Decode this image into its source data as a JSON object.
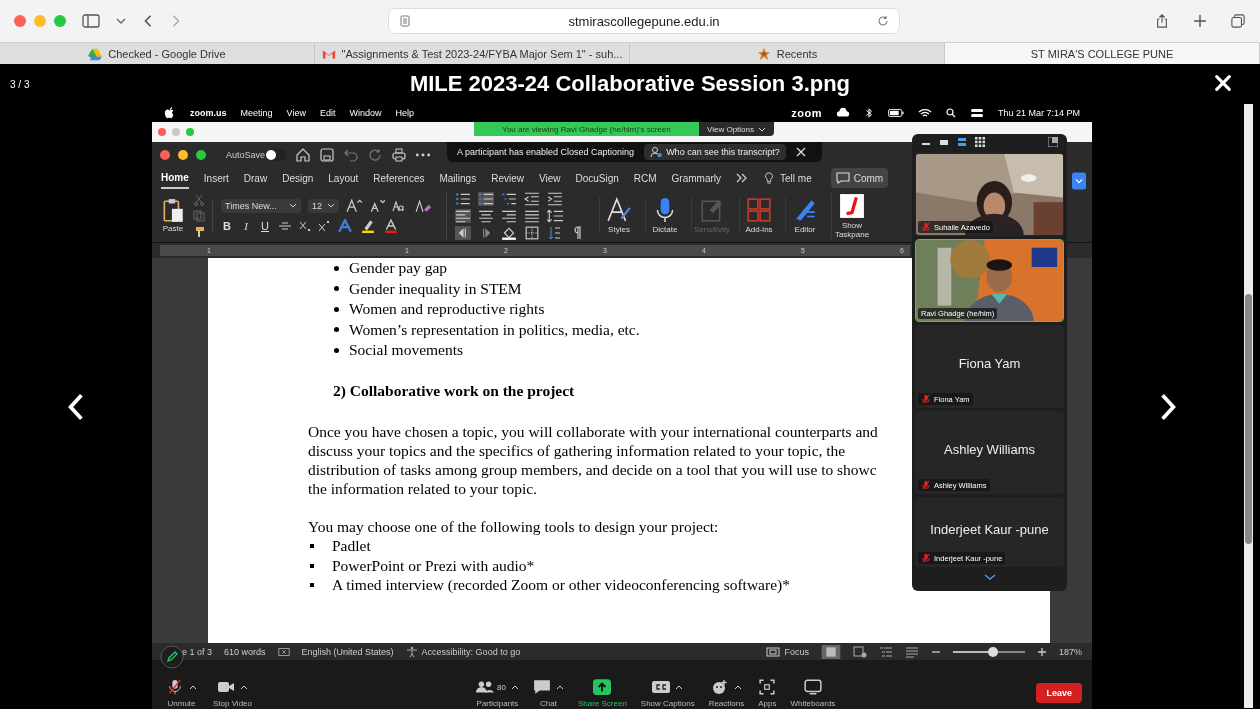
{
  "browser": {
    "url": "stmirascollegepune.edu.in",
    "tabs": [
      {
        "title": "Checked - Google Drive",
        "selected": false
      },
      {
        "title": "\"Assignments & Test 2023-24/FYBA Major Sem 1\" - suh...",
        "selected": false
      },
      {
        "title": "Recents",
        "selected": false
      },
      {
        "title": "ST MIRA'S COLLEGE PUNE",
        "selected": true
      }
    ]
  },
  "viewer": {
    "counter": "3 / 3",
    "title": "MILE 2023-24 Collaborative Session 3.png"
  },
  "menubar": {
    "app": "zoom.us",
    "items": [
      "Meeting",
      "View",
      "Edit",
      "Window",
      "Help"
    ],
    "brand": "zoom",
    "clock": "Thu 21 Mar 7:14 PM"
  },
  "share_banner": {
    "text": "You are viewing Ravi Ghadge (he/him)'s screen",
    "button": "View Options"
  },
  "caption_notice": {
    "text": "A participant has enabled Closed Captioning",
    "link": "Who can see this transcript?"
  },
  "word": {
    "autosave": {
      "label": "AutoSave",
      "on": false
    },
    "tabs": [
      {
        "label": "Home",
        "selected": true
      },
      {
        "label": "Insert",
        "selected": false
      },
      {
        "label": "Draw",
        "selected": false
      },
      {
        "label": "Design",
        "selected": false
      },
      {
        "label": "Layout",
        "selected": false
      },
      {
        "label": "References",
        "selected": false
      },
      {
        "label": "Mailings",
        "selected": false
      },
      {
        "label": "Review",
        "selected": false
      },
      {
        "label": "View",
        "selected": false
      },
      {
        "label": "DocuSign",
        "selected": false
      },
      {
        "label": "RCM",
        "selected": false
      },
      {
        "label": "Grammarly",
        "selected": false
      }
    ],
    "tell_me": "Tell me",
    "comments_button": "Comm",
    "paste": "Paste",
    "font": {
      "name": "Times New...",
      "size": "12"
    },
    "format_buttons": [
      "B",
      "I",
      "U"
    ],
    "commands": [
      {
        "label": "Styles",
        "kind": "styles",
        "disabled": false
      },
      {
        "label": "Dictate",
        "kind": "mic",
        "disabled": false
      },
      {
        "label": "Sensitivity",
        "kind": "tag",
        "disabled": true
      },
      {
        "label": "Add-ins",
        "kind": "grid",
        "disabled": false
      },
      {
        "label": "Editor",
        "kind": "pen",
        "disabled": false
      },
      {
        "label": "Show Taskpane",
        "kind": "taskpane",
        "disabled": false
      }
    ],
    "ruler": [
      "1",
      "1",
      "2",
      "3",
      "4",
      "5",
      "6"
    ],
    "document": {
      "bullets": [
        "Gender pay gap",
        "Gender inequality in STEM",
        "Women and reproductive rights",
        "Women’s representation in politics, media, etc.",
        "Social movements"
      ],
      "heading": "2) Collaborative work on the project",
      "paragraph": [
        "Once you have chosen a topic, you will collaborate with your international counterparts and",
        "discuss your topics and the specifics of gathering information related to your topic, the",
        "distribution of tasks among group members, and decide on a tool that you will use to showc",
        "the information related to your topic."
      ],
      "tools_intro": "You may choose one of the following tools to design your project:",
      "tools": [
        "Padlet",
        "PowerPoint or Prezi with audio*",
        "A timed interview (recorded Zoom or other videoconferencing software)*"
      ]
    },
    "status": {
      "page": "e 1 of 3",
      "words": "610 words",
      "language": "English (United States)",
      "accessibility": "Accessibility: Good to go",
      "focus": "Focus",
      "zoom": "187%",
      "zoom_slider": {
        "level": 0.55
      }
    }
  },
  "participants": [
    {
      "label": "Suhaile Azavedo",
      "kind": "video",
      "muted": true,
      "speaking": false
    },
    {
      "label": "Ravi Ghadge (he/him)",
      "kind": "video",
      "muted": false,
      "speaking": true
    },
    {
      "name": "Fiona Yam",
      "label": "Fiona Yam",
      "kind": "name",
      "muted": true,
      "speaking": false
    },
    {
      "name": "Ashley Williams",
      "label": "Ashley Williams",
      "kind": "name",
      "muted": true,
      "speaking": false
    },
    {
      "name": "Inderjeet Kaur -pune",
      "label": "Inderjeet Kaur -pune",
      "kind": "name",
      "muted": true,
      "speaking": false
    }
  ],
  "toolbar": {
    "left": [
      {
        "label": "Unmute",
        "kind": "mic-off",
        "caret": true
      },
      {
        "label": "Stop Video",
        "kind": "video",
        "caret": true
      }
    ],
    "center": [
      {
        "label": "Participants",
        "kind": "people",
        "count": "80",
        "caret": true,
        "highlight": false
      },
      {
        "label": "Chat",
        "kind": "chat",
        "caret": true,
        "highlight": false
      },
      {
        "label": "Share Screen",
        "kind": "share",
        "caret": false,
        "highlight": true
      },
      {
        "label": "Show Captions",
        "kind": "cc",
        "caret": true,
        "highlight": false
      },
      {
        "label": "Reactions",
        "kind": "smile",
        "caret": true,
        "highlight": false
      },
      {
        "label": "Apps",
        "kind": "apps",
        "caret": false,
        "highlight": false
      },
      {
        "label": "Whiteboards",
        "kind": "board",
        "caret": false,
        "highlight": false
      }
    ],
    "leave": "Leave"
  }
}
